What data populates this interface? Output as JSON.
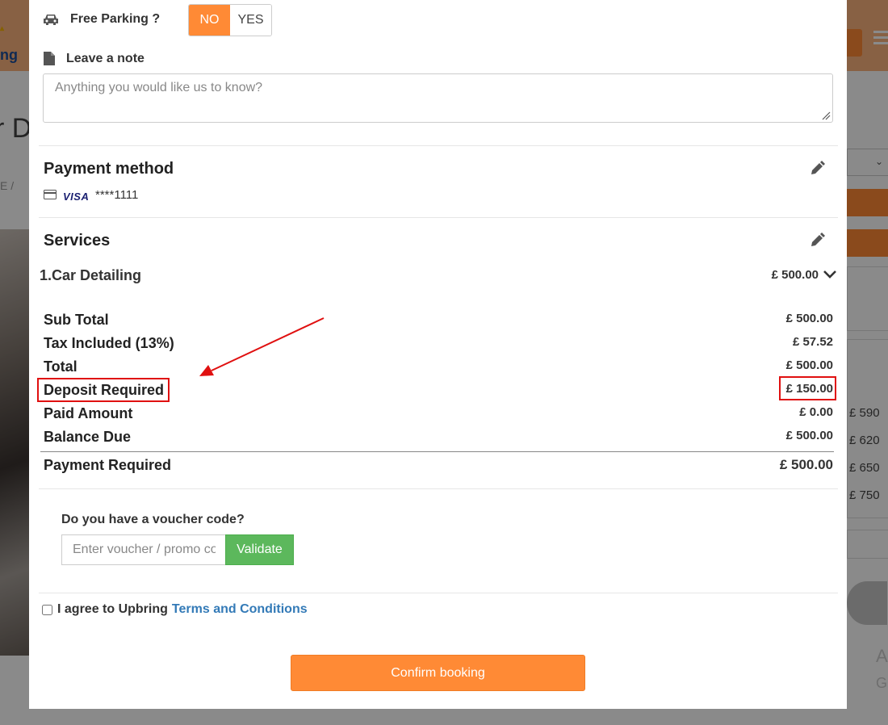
{
  "background": {
    "logo_text": "ng",
    "title_fragment": "r D",
    "breadcrumb_fragment": "E /",
    "prices": [
      "£ 590",
      "£ 620",
      "£ 650",
      "£ 750"
    ],
    "side_letters": [
      "A",
      "G"
    ]
  },
  "modal": {
    "parking": {
      "label": "Free Parking ?",
      "options": [
        "NO",
        "YES"
      ],
      "selected": "NO"
    },
    "note": {
      "label": "Leave a note",
      "placeholder": "Anything you would like us to know?"
    },
    "payment": {
      "title": "Payment method",
      "card_brand": "VISA",
      "card_mask": "****1111"
    },
    "services": {
      "title": "Services",
      "items": [
        {
          "name": "1.Car Detailing",
          "price": "£ 500.00"
        }
      ]
    },
    "summary": {
      "rows": [
        {
          "label": "Sub Total",
          "value": "£ 500.00"
        },
        {
          "label": "Tax Included (13%)",
          "value": "£ 57.52"
        },
        {
          "label": "Total",
          "value": "£ 500.00"
        },
        {
          "label": "Deposit Required",
          "value": "£ 150.00"
        },
        {
          "label": "Paid Amount",
          "value": "£ 0.00"
        },
        {
          "label": "Balance Due",
          "value": "£ 500.00"
        }
      ],
      "payment_required_label": "Payment Required",
      "payment_required_value": "£ 500.00"
    },
    "voucher": {
      "question": "Do you have a voucher code?",
      "placeholder": "Enter voucher / promo code",
      "validate_label": "Validate"
    },
    "agree": {
      "text": "I agree to Upbring",
      "link": "Terms and Conditions"
    },
    "confirm_label": "Confirm booking"
  },
  "colors": {
    "accent": "#ff8a35",
    "validate": "#5cb85c",
    "link": "#337ab7",
    "annotation": "#e01010"
  }
}
